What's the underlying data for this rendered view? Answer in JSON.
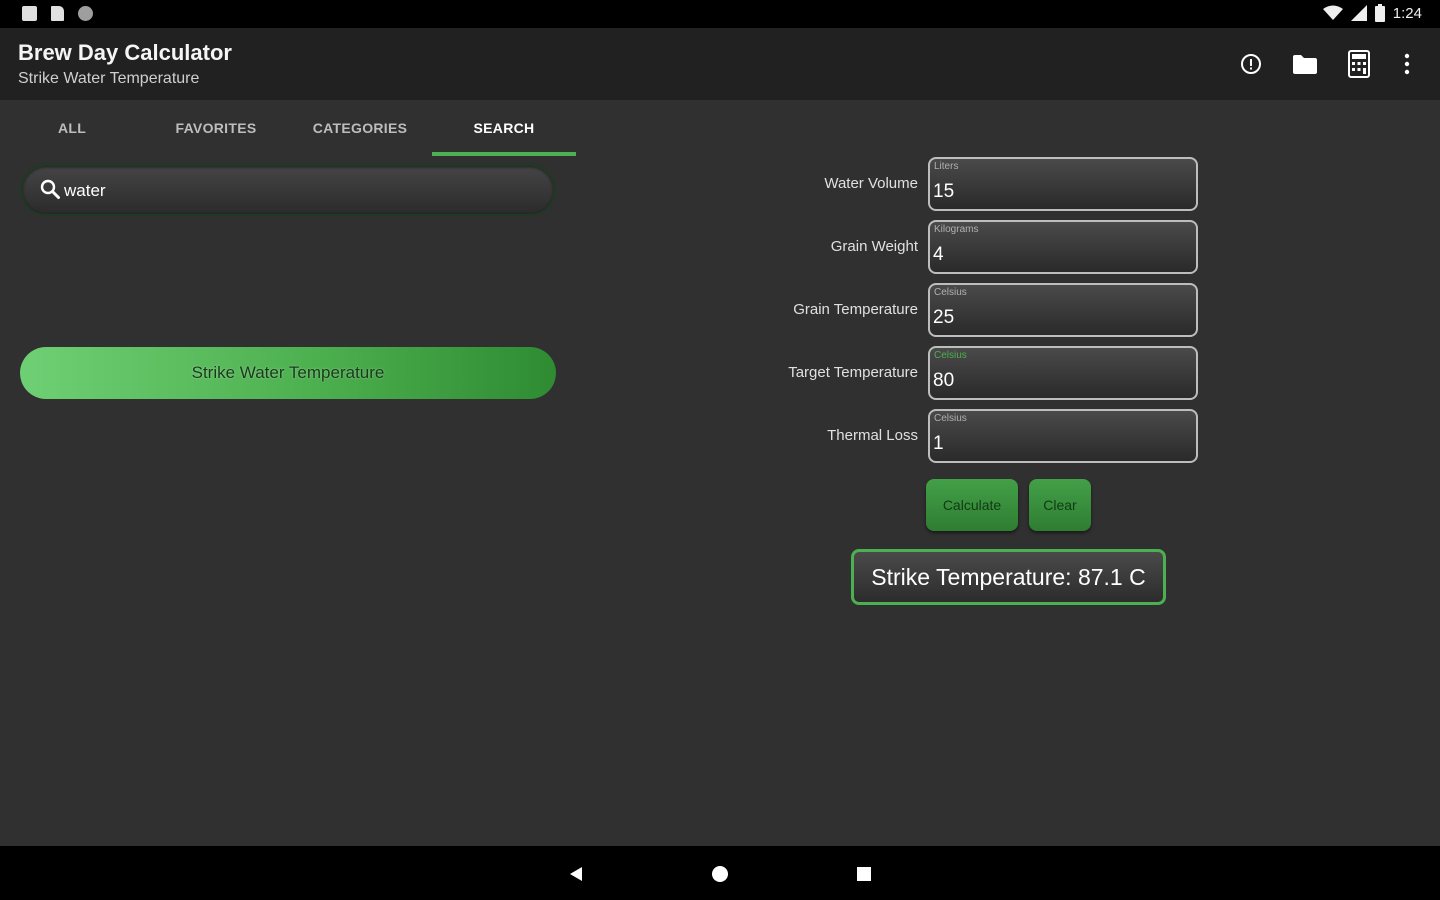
{
  "status_bar": {
    "time": "1:24",
    "left_icons": [
      "notification-icon",
      "sd-card-icon",
      "sync-icon"
    ],
    "right_icons": [
      "wifi-icon",
      "signal-icon",
      "battery-icon"
    ]
  },
  "app_bar": {
    "title": "Brew Day Calculator",
    "subtitle": "Strike Water Temperature",
    "actions": [
      "info-icon",
      "folder-icon",
      "calculator-icon",
      "overflow-menu-icon"
    ]
  },
  "tabs": [
    {
      "label": "ALL",
      "active": false
    },
    {
      "label": "FAVORITES",
      "active": false
    },
    {
      "label": "CATEGORIES",
      "active": false
    },
    {
      "label": "SEARCH",
      "active": true
    }
  ],
  "search": {
    "value": "water",
    "placeholder": ""
  },
  "results": [
    {
      "label": "Strike Water Temperature"
    }
  ],
  "form": {
    "fields": [
      {
        "label": "Water Volume",
        "unit": "Liters",
        "value": "15"
      },
      {
        "label": "Grain Weight",
        "unit": "Kilograms",
        "value": "4"
      },
      {
        "label": "Grain Temperature",
        "unit": "Celsius",
        "value": "25"
      },
      {
        "label": "Target Temperature",
        "unit": "Celsius",
        "value": "80"
      },
      {
        "label": "Thermal Loss",
        "unit": "Celsius",
        "value": "1"
      }
    ],
    "calculate_label": "Calculate",
    "clear_label": "Clear",
    "result_text": "Strike Temperature: 87.1 C"
  },
  "colors": {
    "accent": "#4caf50",
    "background": "#303030",
    "app_bar": "#212121"
  },
  "nav_bar": [
    "back-icon",
    "home-icon",
    "recents-icon"
  ]
}
